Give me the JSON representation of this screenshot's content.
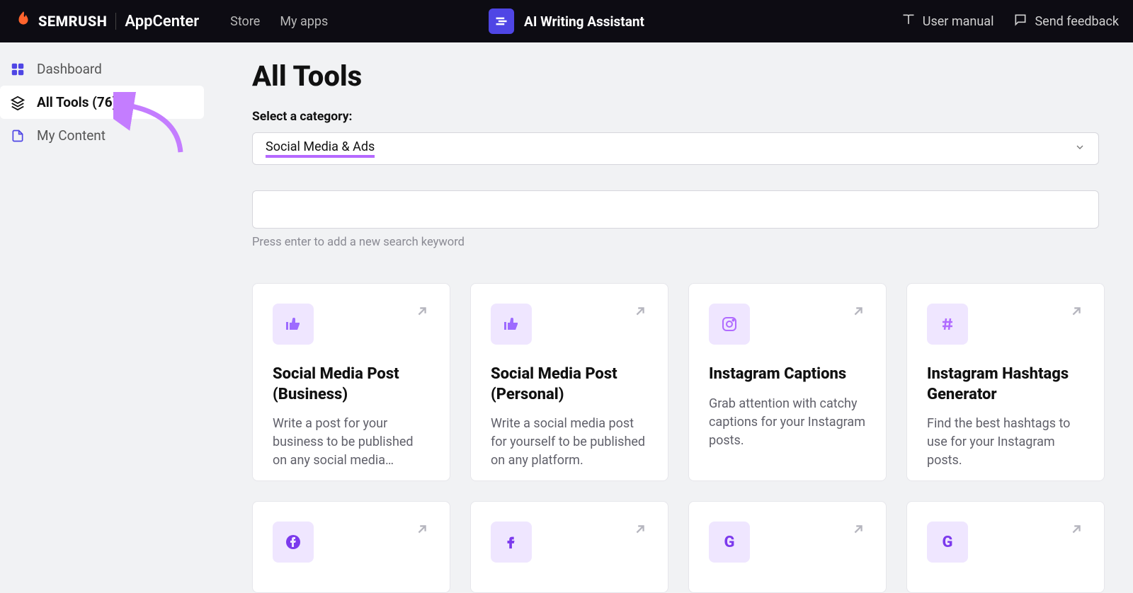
{
  "header": {
    "brand": "SEMRUSH",
    "appcenter": "AppCenter",
    "nav": {
      "store": "Store",
      "myapps": "My apps"
    },
    "app_name": "AI Writing Assistant",
    "actions": {
      "manual": "User manual",
      "feedback": "Send feedback"
    }
  },
  "sidebar": {
    "dashboard": "Dashboard",
    "all_tools": "All Tools (76)",
    "my_content": "My Content"
  },
  "page": {
    "title": "All Tools",
    "category_label": "Select a category:",
    "category_value": "Social Media & Ads",
    "search_hint": "Press enter to add a new search keyword"
  },
  "cards": [
    {
      "icon": "thumb",
      "title": "Social Media Post (Business)",
      "desc": "Write a post for your business to be published on any social media…"
    },
    {
      "icon": "thumb",
      "title": "Social Media Post (Personal)",
      "desc": "Write a social media post for yourself to be published on any platform."
    },
    {
      "icon": "instagram",
      "title": "Instagram Captions",
      "desc": "Grab attention with catchy captions for your Instagram posts."
    },
    {
      "icon": "hashtag",
      "title": "Instagram Hashtags Generator",
      "desc": "Find the best hashtags to use for your Instagram posts."
    },
    {
      "icon": "facebook",
      "title": "",
      "desc": ""
    },
    {
      "icon": "facebook",
      "title": "",
      "desc": ""
    },
    {
      "icon": "google",
      "title": "",
      "desc": ""
    },
    {
      "icon": "google",
      "title": "",
      "desc": ""
    }
  ]
}
